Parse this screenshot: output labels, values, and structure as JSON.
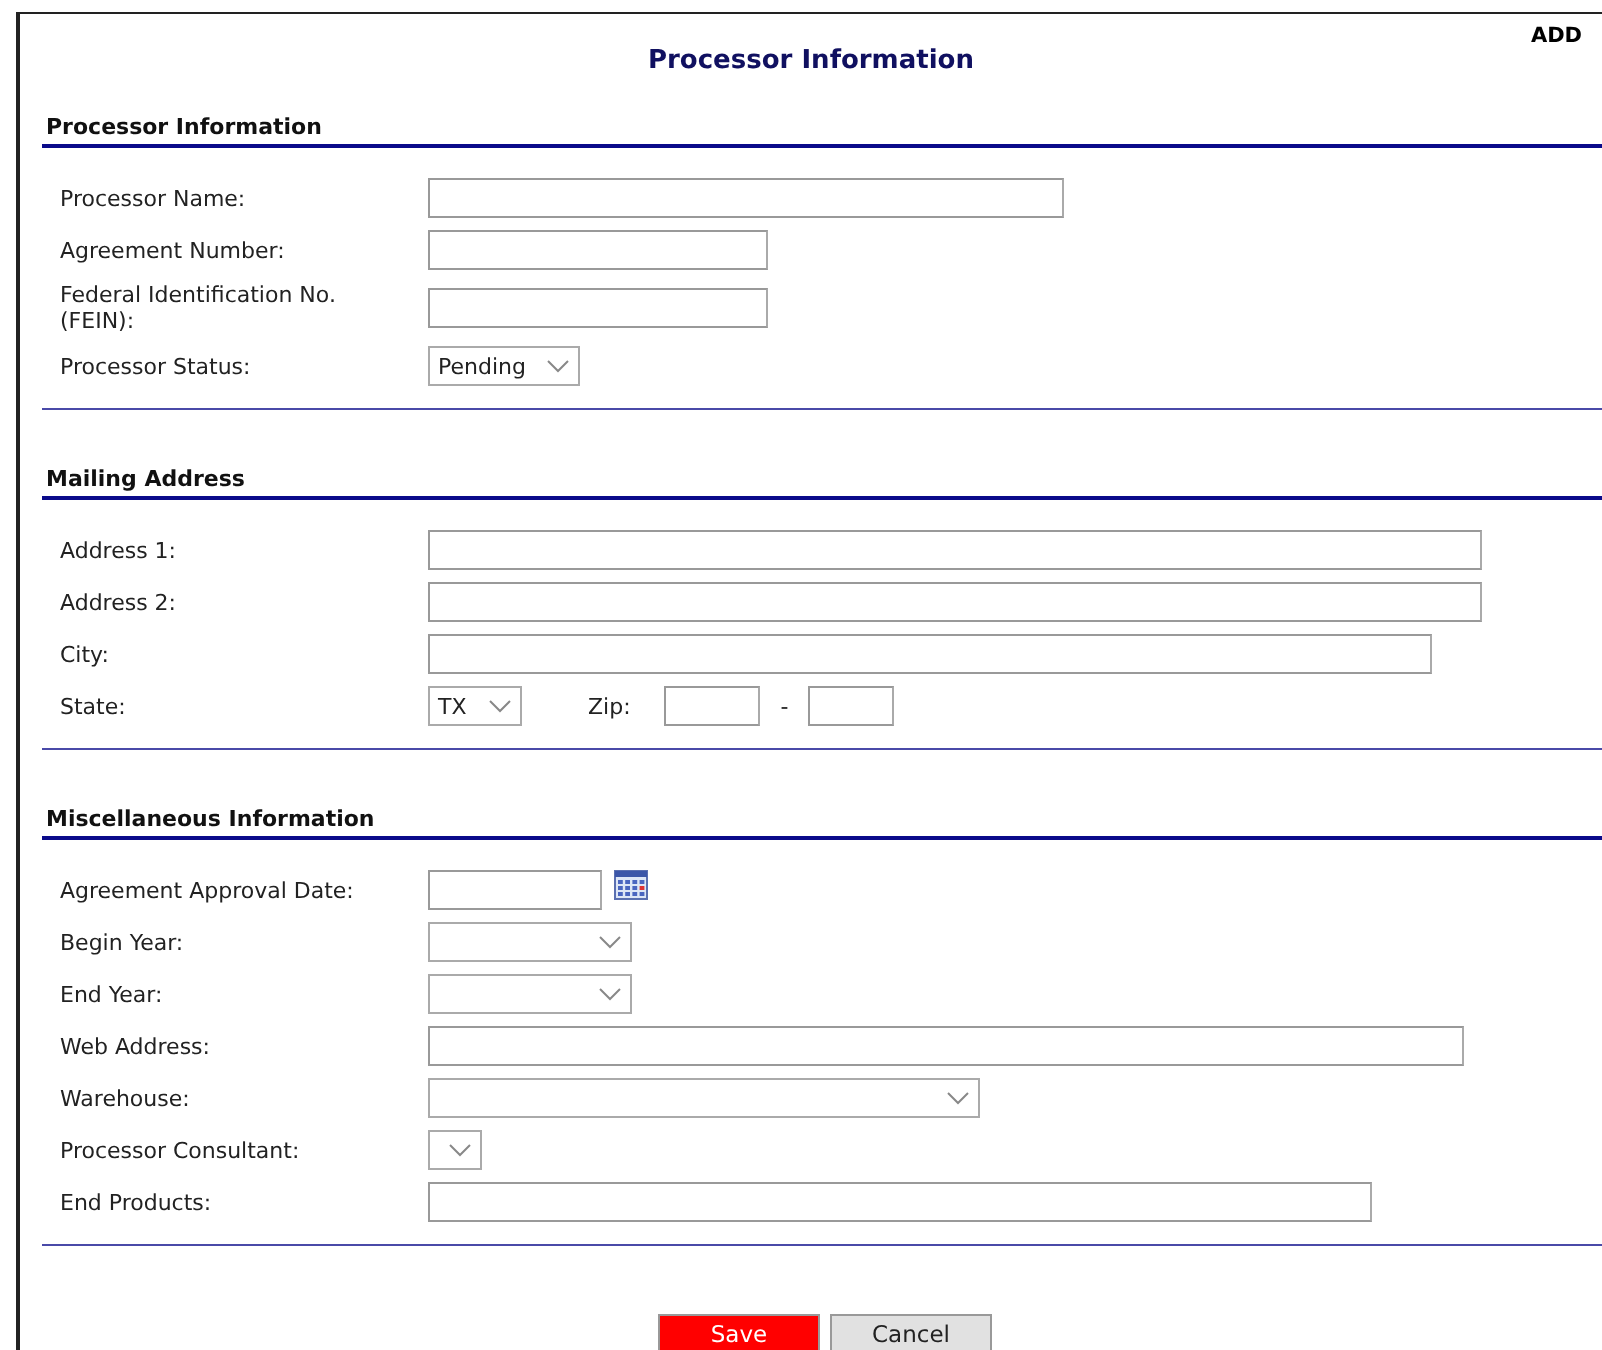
{
  "mode_label": "ADD",
  "title": "Processor Information",
  "sections": [
    {
      "heading": "Processor Information",
      "rows": [
        {
          "kind": "text",
          "label": "Processor Name:"
        },
        {
          "kind": "text",
          "label": "Agreement Number:"
        },
        {
          "kind": "text",
          "label": "Federal Identification No. (FEIN):"
        },
        {
          "kind": "select",
          "label": "Processor Status:",
          "value": "Pending"
        }
      ]
    },
    {
      "heading": "Mailing Address",
      "rows": [
        {
          "kind": "text",
          "label": "Address 1:"
        },
        {
          "kind": "text",
          "label": "Address 2:"
        },
        {
          "kind": "text",
          "label": "City:"
        },
        {
          "kind": "state_zip",
          "label": "State:",
          "value": "TX",
          "zip_label": "Zip:",
          "zip_separator": "-"
        }
      ]
    },
    {
      "heading": "Miscellaneous Information",
      "rows": [
        {
          "kind": "date",
          "label": "Agreement Approval Date:"
        },
        {
          "kind": "select",
          "label": "Begin Year:"
        },
        {
          "kind": "select",
          "label": "End Year:"
        },
        {
          "kind": "text",
          "label": "Web Address:"
        },
        {
          "kind": "select",
          "label": "Warehouse:"
        },
        {
          "kind": "select",
          "label": "Processor Consultant:"
        },
        {
          "kind": "text",
          "label": "End Products:"
        }
      ]
    }
  ],
  "buttons": [
    {
      "kind": "primary",
      "label": "Save"
    },
    {
      "kind": "secondary",
      "label": "Cancel"
    }
  ]
}
